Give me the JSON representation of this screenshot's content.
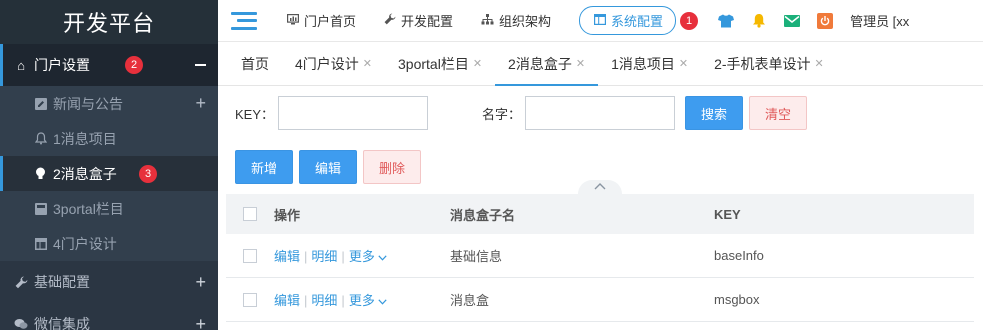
{
  "sidebar": {
    "brand": "开发平台",
    "groups": [
      {
        "label": "门户设置",
        "badge": "2"
      },
      {
        "label": "基础配置"
      },
      {
        "label": "微信集成"
      }
    ],
    "sub_items": [
      {
        "label": "新闻与公告"
      },
      {
        "label": "1消息项目"
      },
      {
        "label": "2消息盒子",
        "badge": "3"
      },
      {
        "label": "3portal栏目"
      },
      {
        "label": "4门户设计"
      }
    ]
  },
  "topbar": {
    "items": [
      {
        "label": "门户首页"
      },
      {
        "label": "开发配置"
      },
      {
        "label": "组织架构"
      },
      {
        "label": "系统配置"
      }
    ],
    "active_badge": "1",
    "user": "管理员 [xx"
  },
  "tabs": [
    {
      "label": "首页"
    },
    {
      "label": "4门户设计"
    },
    {
      "label": "3portal栏目"
    },
    {
      "label": "2消息盒子"
    },
    {
      "label": "1消息项目"
    },
    {
      "label": "2-手机表单设计"
    }
  ],
  "search": {
    "key_label": "KEY：",
    "name_label": "名字：",
    "search_button": "搜索",
    "clear_button": "清空"
  },
  "actions": {
    "add": "新增",
    "edit": "编辑",
    "delete": "删除"
  },
  "table": {
    "headers": {
      "op": "操作",
      "name": "消息盒子名",
      "key": "KEY"
    },
    "op_labels": {
      "edit": "编辑",
      "detail": "明细",
      "more": "更多"
    },
    "rows": [
      {
        "name": "基础信息",
        "key": "baseInfo"
      },
      {
        "name": "消息盒",
        "key": "msgbox"
      }
    ]
  },
  "colors": {
    "sidebar_bg": "#2b3643",
    "accent": "#3598dc",
    "badge": "#e7303c",
    "danger_text": "#e05959"
  },
  "icons": {
    "tshirt": "#3598dc",
    "bell": "#f5b800",
    "mail": "#1bb07a",
    "power": "#f07a3a"
  }
}
